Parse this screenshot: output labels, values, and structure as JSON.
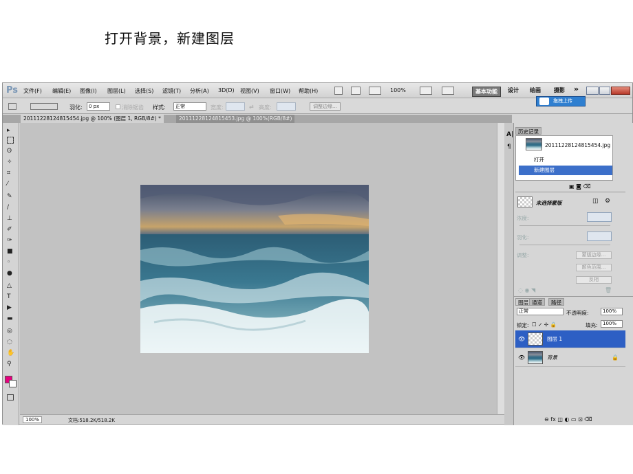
{
  "caption": "打开背景，新建图层",
  "app": {
    "logo": "Ps",
    "menus": [
      "文件(F)",
      "编辑(E)",
      "图像(I)",
      "图层(L)",
      "选择(S)",
      "滤镜(T)",
      "分析(A)",
      "3D(D)",
      "视图(V)",
      "窗口(W)",
      "帮助(H)"
    ],
    "zoom_display": "100%",
    "workspaces": [
      "基本功能",
      "设计",
      "绘画",
      "摄影"
    ],
    "more": "»",
    "upload_label": "拖拽上传"
  },
  "options": {
    "feather_label": "羽化:",
    "feather_value": "0 px",
    "antialias": "消除锯齿",
    "style_label": "样式:",
    "style_value": "正常",
    "width_label": "宽度:",
    "height_label": "高度:",
    "refine_edge": "调整边缘..."
  },
  "tabs": [
    {
      "label": "20111228124815454.jpg @ 100% (图层 1, RGB/8#) *",
      "active": true
    },
    {
      "label": "20111228124815453.jpg @ 100%(RGB/8#)",
      "active": false
    }
  ],
  "status": {
    "zoom": "100%",
    "doc": "文档:518.2K/518.2K"
  },
  "history": {
    "title": "历史记录",
    "snapshot": "20111228124815454.jpg",
    "items": [
      {
        "label": "打开",
        "selected": false
      },
      {
        "label": "新建图层",
        "selected": true
      }
    ]
  },
  "masks": {
    "title": "未选择蒙版",
    "density": "浓度:",
    "feather": "羽化:",
    "refine": "调整:",
    "btn_mask_edge": "蒙版边缘...",
    "btn_color_range": "颜色范围...",
    "btn_invert": "反相"
  },
  "layers_panel": {
    "tabs": [
      "图层",
      "通道",
      "路径"
    ],
    "blend_mode": "正常",
    "opacity_label": "不透明度:",
    "opacity_value": "100%",
    "lock_label": "锁定:",
    "fill_label": "填充:",
    "fill_value": "100%",
    "layers": [
      {
        "name": "图层 1",
        "selected": true
      },
      {
        "name": "背景",
        "selected": false
      }
    ]
  },
  "colors": {
    "foreground": "#e6007e",
    "background": "#ffffff",
    "selection": "#2d5fc4"
  }
}
